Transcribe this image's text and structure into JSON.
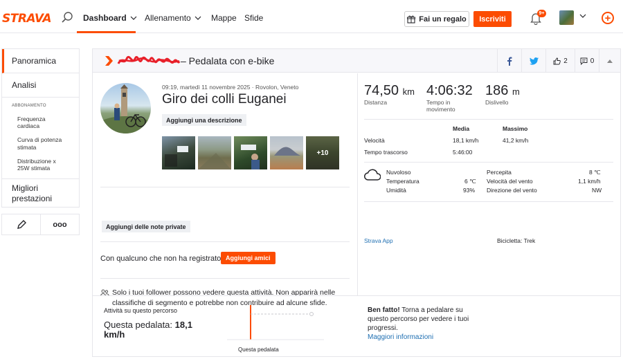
{
  "nav": {
    "logo": "STRAVA",
    "items": [
      "Dashboard",
      "Allenamento",
      "Mappe",
      "Sfide"
    ],
    "gift_label": "Fai un regalo",
    "subscribe_label": "Iscriviti",
    "notifications_badge": "9+"
  },
  "sidebar": {
    "overview": "Panoramica",
    "analysis": "Analisi",
    "subscription_section": "ABBONAMENTO",
    "sub_items": [
      "Frequenza cardiaca",
      "Curva di potenza stimata",
      "Distribuzione x 25W stimata"
    ],
    "best_efforts": "Migliori prestazioni",
    "more_label": "ooo"
  },
  "header": {
    "title": "– Pedalata con e-bike",
    "kudos_count": "2",
    "comments_count": "0"
  },
  "activity": {
    "meta": "09:19, martedì 11 novembre 2025 · Rovolon, Veneto",
    "title": "Giro dei colli Euganei",
    "add_description": "Aggiungi una descrizione",
    "photos_more": "+10",
    "add_private_notes": "Aggiungi delle note private",
    "friends_question": "Con qualcuno che non ha registrato?",
    "add_friends": "Aggiungi amici",
    "privacy_line1": "Solo i tuoi follower possono vedere questa attività. Non apparirà nelle",
    "privacy_line2": "classifiche di segmento e potrebbe non contribuire ad alcune sfide."
  },
  "stats": {
    "distance_value": "74,50",
    "distance_unit": "km",
    "distance_label": "Distanza",
    "time_value": "4:06:32",
    "time_label_1": "Tempo in",
    "time_label_2": "movimento",
    "elevation_value": "186",
    "elevation_unit": "m",
    "elevation_label": "Dislivello"
  },
  "details": {
    "col_avg": "Media",
    "col_max": "Massimo",
    "speed_label": "Velocità",
    "speed_avg": "18,1 km/h",
    "speed_max": "41,2 km/h",
    "elapsed_label": "Tempo trascorso",
    "elapsed_value": "5:46:00"
  },
  "weather": {
    "condition": "Nuvoloso",
    "temp_label": "Temperatura",
    "temp_value": "6 ℃",
    "humidity_label": "Umidità",
    "humidity_value": "93%",
    "feels_label": "Percepita",
    "feels_value": "8 ℃",
    "wind_speed_label": "Velocità del vento",
    "wind_speed_value": "1,1 km/h",
    "wind_dir_label": "Direzione del vento",
    "wind_dir_value": "NW"
  },
  "device": {
    "app": "Strava App",
    "bike": "Bicicletta: Trek"
  },
  "segment": {
    "route_label": "Attività su questo percorso",
    "this_ride_label": "Questa pedalata: ",
    "this_ride_value": "18,1",
    "this_ride_unit": "km/h",
    "chart_label": "Questa pedalata",
    "well_done": "Ben fatto!",
    "well_done_text": " Torna a pedalare su questo percorso per vedere i tuoi progressi.",
    "more_info": "Maggiori informazioni"
  }
}
